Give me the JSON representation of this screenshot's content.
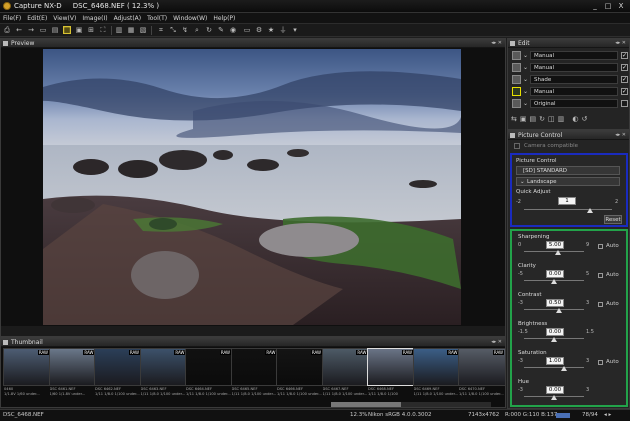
{
  "window": {
    "title": "Capture NX-D     DSC_6468.NEF ( 12.3% )",
    "minimize": "_",
    "maximize": "□",
    "close": "X"
  },
  "menu": [
    "File(F)",
    "Edit(E)",
    "View(V)",
    "Image(I)",
    "Adjust(A)",
    "Tool(T)",
    "Window(W)",
    "Help(P)"
  ],
  "toolbar_icons": [
    "print-icon",
    "back-icon",
    "forward-icon",
    "open-folder-icon",
    "browser-icon",
    "grid-icon",
    "viewer-icon",
    "compare-icon",
    "fullscreen-icon",
    "crop-icon",
    "straighten-icon",
    "zoom-icon",
    "hand-icon",
    "rotate-icon",
    "settings-icon",
    "pin-icon",
    "star-icon",
    "filter-icon",
    "dropdown-icon"
  ],
  "preview": {
    "title": "Preview"
  },
  "thumbnails": {
    "title": "Thumbnail",
    "items": [
      {
        "name": "0460",
        "info": "1/1.8V 1/60 under..."
      },
      {
        "name": "DSC 6461.NEF",
        "info": "1/60 1/1.8V under..."
      },
      {
        "name": "DSC 6462.NEF",
        "info": "1/11 1/8.0 1/100 under..."
      },
      {
        "name": "DSC 6463.NEF",
        "info": "1/11 1/8.0 1/100 under..."
      },
      {
        "name": "DSC 6464.NEF",
        "info": "1/11 1/8.0 1/100 under..."
      },
      {
        "name": "DSC 6465.NEF",
        "info": "1/11 1/8.0 1/100 under..."
      },
      {
        "name": "DSC 6466.NEF",
        "info": "1/11 1/8.0 1/100 under..."
      },
      {
        "name": "DSC 6467.NEF",
        "info": "1/11 1/8.0 1/100 under..."
      },
      {
        "name": "DSC 6468.NEF",
        "info": "1/11 1/8.0 1/100"
      },
      {
        "name": "DSC 6469.NEF",
        "info": "1/11 1/8.0 1/100 under..."
      },
      {
        "name": "DSC 6470.NEF",
        "info": "1/11 1/8.0 1/100 under..."
      }
    ]
  },
  "status": {
    "file": "DSC_6468.NEF",
    "zoom": "12.3%",
    "profile": "Nikon sRGB 4.0.0.3002",
    "size": "7143x4762",
    "rgb": "R:000 G:110 B:137",
    "count": "78/94"
  },
  "edit": {
    "title": "Edit",
    "rows": [
      {
        "value": "Manual",
        "checked": true
      },
      {
        "value": "Manual",
        "checked": true
      },
      {
        "value": "Shade",
        "checked": true
      },
      {
        "value": "Manual",
        "checked": true
      },
      {
        "value": "Original",
        "checked": false
      }
    ]
  },
  "picture_control": {
    "title": "Picture Control",
    "camera_compatible": "Camera compatible",
    "section": "Picture Control",
    "selected": "[SD] STANDARD",
    "base": "Landscape",
    "quick_adjust": {
      "label": "Quick Adjust",
      "value": "1",
      "min": "-2",
      "max": "2"
    },
    "reset": "Reset",
    "params": [
      {
        "label": "Sharpening",
        "min": "0",
        "max": "9",
        "value": "5.00",
        "auto": "Auto",
        "level": 0.56
      },
      {
        "label": "Clarity",
        "min": "-5",
        "max": "5",
        "value": "0.00",
        "auto": "Auto",
        "level": 0.5
      },
      {
        "label": "Contrast",
        "min": "-3",
        "max": "3",
        "value": "0.50",
        "auto": "Auto",
        "level": 0.58
      },
      {
        "label": "Brightness",
        "min": "-1.5",
        "max": "1.5",
        "value": "0.00",
        "level": 0.5
      },
      {
        "label": "Saturation",
        "min": "-3",
        "max": "3",
        "value": "1.00",
        "auto": "Auto",
        "level": 0.67
      },
      {
        "label": "Hue",
        "min": "-3",
        "max": "3",
        "value": "0.00",
        "level": 0.5
      }
    ]
  },
  "colors": {
    "blue_frame": "#1a2bbf",
    "green_frame": "#22a34a",
    "highlight": "#e8e000"
  }
}
